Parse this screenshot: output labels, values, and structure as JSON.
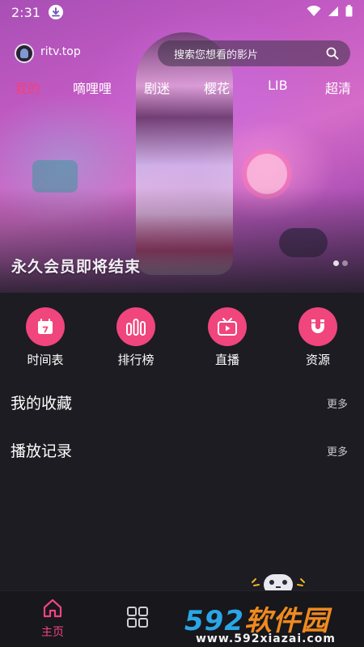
{
  "status_bar": {
    "time": "2:31"
  },
  "header": {
    "site_name": "ritv.top",
    "search_placeholder": "搜索您想看的影片"
  },
  "tabs": [
    {
      "label": "我的",
      "active": true
    },
    {
      "label": "嘀哩哩"
    },
    {
      "label": "剧迷"
    },
    {
      "label": "樱花"
    },
    {
      "label": "LIB"
    },
    {
      "label": "超清"
    }
  ],
  "banner": {
    "caption": "永久会员即将结束"
  },
  "quick_links": [
    {
      "label": "时间表",
      "icon": "calendar-icon"
    },
    {
      "label": "排行榜",
      "icon": "ranking-bars-icon"
    },
    {
      "label": "直播",
      "icon": "tv-icon"
    },
    {
      "label": "资源",
      "icon": "magnet-icon"
    }
  ],
  "sections": [
    {
      "title": "我的收藏",
      "more": "更多"
    },
    {
      "title": "播放记录",
      "more": "更多"
    }
  ],
  "bottom_nav": {
    "home_label": "主页"
  },
  "watermark": {
    "brand": "592软件园",
    "url": "www.592xiazai.com"
  },
  "colors": {
    "accent": "#f0457d",
    "background": "#1c1c22"
  }
}
